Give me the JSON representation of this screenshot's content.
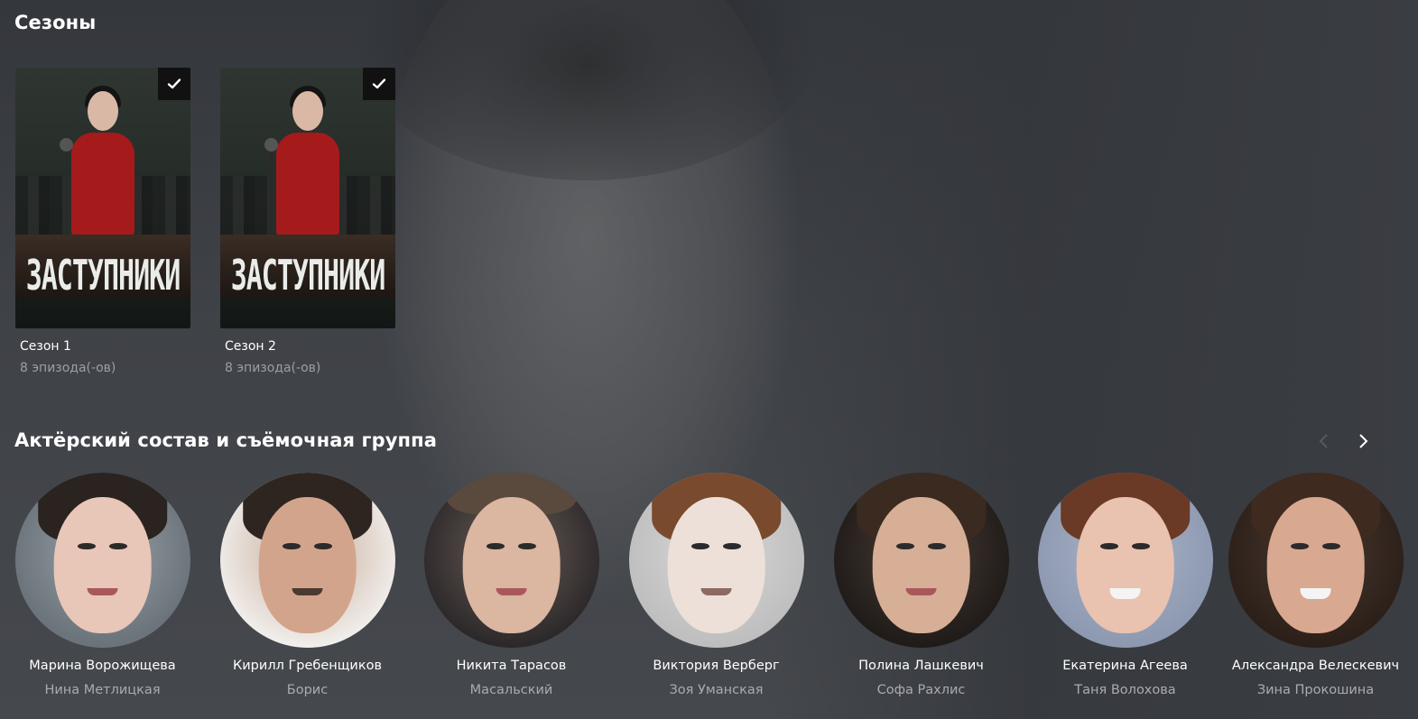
{
  "seasons": {
    "title": "Сезоны",
    "items": [
      {
        "name": "Сезон 1",
        "episodes": "8 эпизода(-ов)",
        "poster_text": "ЗАСТУПНИКИ",
        "watched": true
      },
      {
        "name": "Сезон 2",
        "episodes": "8 эпизода(-ов)",
        "poster_text": "ЗАСТУПНИКИ",
        "watched": true
      }
    ]
  },
  "cast": {
    "title": "Актёрский состав и съёмочная группа",
    "people": [
      {
        "name": "Марина Ворожищева",
        "role": "Нина Метлицкая"
      },
      {
        "name": "Кирилл Гребенщиков",
        "role": "Борис"
      },
      {
        "name": "Никита Тарасов",
        "role": "Масальский"
      },
      {
        "name": "Виктория Верберг",
        "role": "Зоя Уманская"
      },
      {
        "name": "Полина Лашкевич",
        "role": "Софа Рахлис"
      },
      {
        "name": "Екатерина Агеева",
        "role": "Таня Волохова"
      },
      {
        "name": "Александра Велескевич",
        "role": "Зина Прокошина"
      }
    ]
  },
  "icons": {
    "watched": "check-icon",
    "prev": "chevron-left-icon",
    "next": "chevron-right-icon"
  },
  "colors": {
    "background": "#3b3e44",
    "text": "#ffffff",
    "muted_text": "#9c9ea2",
    "poster_title": "#e9ece8",
    "badge": "#111111"
  }
}
